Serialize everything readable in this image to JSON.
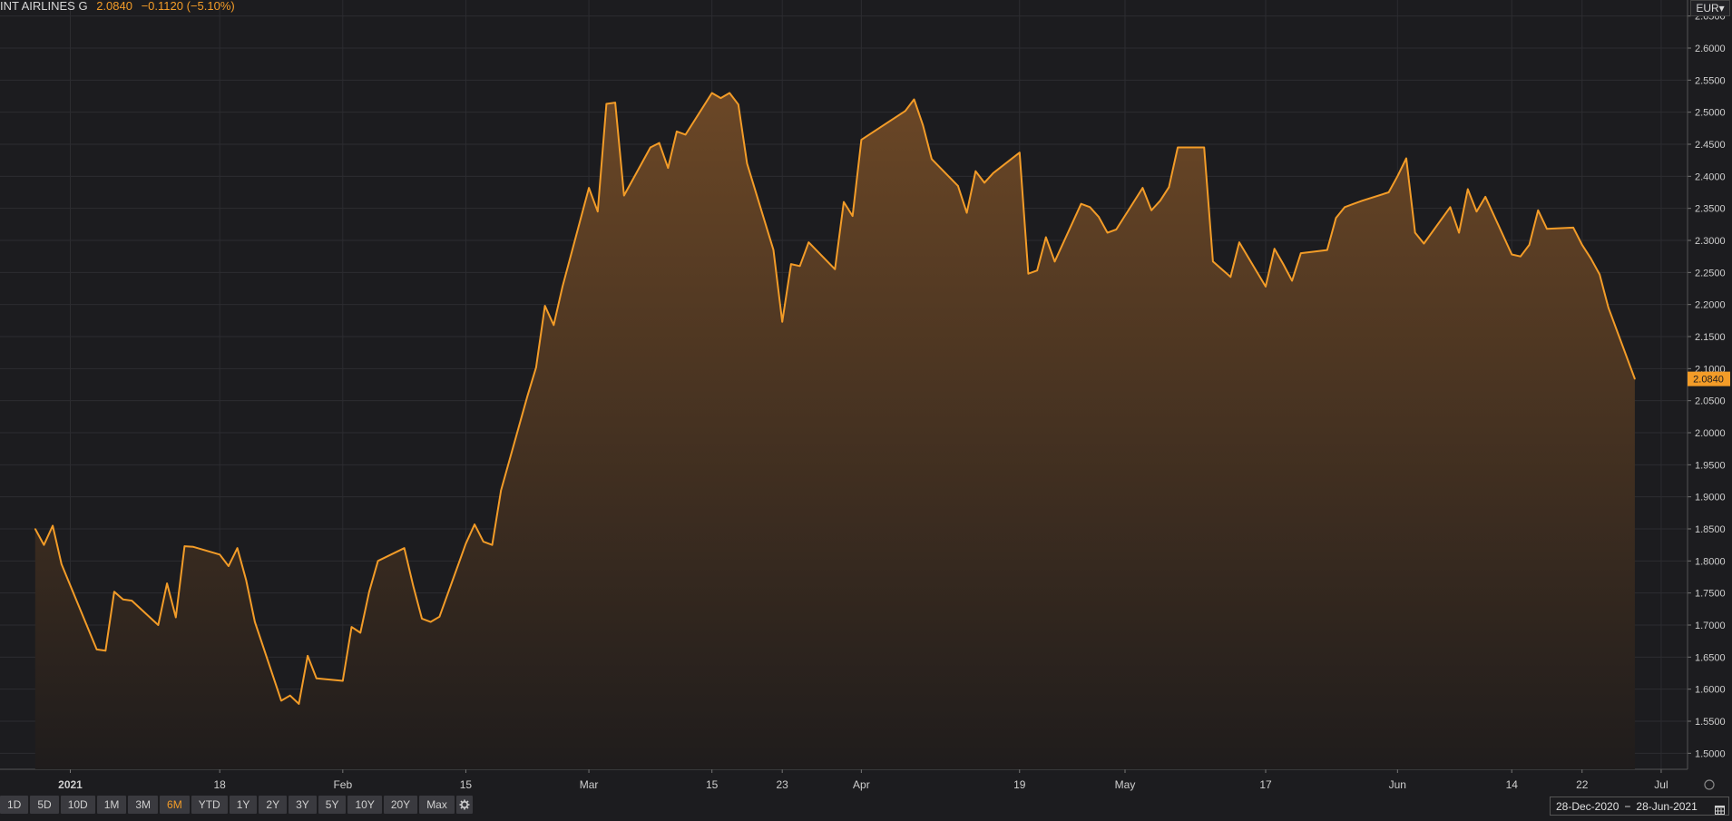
{
  "header": {
    "name": "INT AIRLINES G",
    "price": "2.0840",
    "change": "−0.1120 (−5.10%)"
  },
  "currency": "EUR▾",
  "ranges": [
    "1D",
    "5D",
    "10D",
    "1M",
    "3M",
    "6M",
    "YTD",
    "1Y",
    "2Y",
    "3Y",
    "5Y",
    "10Y",
    "20Y",
    "Max"
  ],
  "active_range": "6M",
  "date_range": {
    "from": "28-Dec-2020",
    "sep": "−",
    "to": "28-Jun-2021"
  },
  "colors": {
    "line": "#f39c28",
    "background": "#1c1c1f",
    "grid": "#2c2c30",
    "text": "#cfcfcf"
  },
  "chart_data": {
    "type": "area",
    "last_value_label": "2.0840",
    "ylim": [
      1.475,
      2.675
    ],
    "y_ticks": [
      "1.5000",
      "1.5500",
      "1.6000",
      "1.6500",
      "1.7000",
      "1.7500",
      "1.8000",
      "1.8500",
      "1.9000",
      "1.9500",
      "2.0000",
      "2.0500",
      "2.1000",
      "2.1500",
      "2.2000",
      "2.2500",
      "2.3000",
      "2.3500",
      "2.4000",
      "2.4500",
      "2.5000",
      "2.5500",
      "2.6000",
      "2.6500"
    ],
    "x_ticks": [
      {
        "label": "2021",
        "date": "2021-01-01",
        "bold": true
      },
      {
        "label": "18",
        "date": "2021-01-18"
      },
      {
        "label": "Feb",
        "date": "2021-02-01"
      },
      {
        "label": "15",
        "date": "2021-02-15"
      },
      {
        "label": "Mar",
        "date": "2021-03-01"
      },
      {
        "label": "15",
        "date": "2021-03-15"
      },
      {
        "label": "23",
        "date": "2021-03-23"
      },
      {
        "label": "Apr",
        "date": "2021-04-01"
      },
      {
        "label": "19",
        "date": "2021-04-19"
      },
      {
        "label": "May",
        "date": "2021-05-01"
      },
      {
        "label": "17",
        "date": "2021-05-17"
      },
      {
        "label": "Jun",
        "date": "2021-06-01"
      },
      {
        "label": "14",
        "date": "2021-06-14"
      },
      {
        "label": "22",
        "date": "2021-06-22"
      },
      {
        "label": "Jul",
        "date": "2021-07-01"
      }
    ],
    "series": [
      {
        "x": [
          "2020-12-28",
          "2020-12-29",
          "2020-12-30",
          "2020-12-31",
          "2021-01-04",
          "2021-01-05",
          "2021-01-06",
          "2021-01-07",
          "2021-01-08",
          "2021-01-11",
          "2021-01-12",
          "2021-01-13",
          "2021-01-14",
          "2021-01-15",
          "2021-01-18",
          "2021-01-19",
          "2021-01-20",
          "2021-01-21",
          "2021-01-22",
          "2021-01-25",
          "2021-01-26",
          "2021-01-27",
          "2021-01-28",
          "2021-01-29",
          "2021-02-01",
          "2021-02-02",
          "2021-02-03",
          "2021-02-04",
          "2021-02-05",
          "2021-02-08",
          "2021-02-09",
          "2021-02-10",
          "2021-02-11",
          "2021-02-12",
          "2021-02-15",
          "2021-02-16",
          "2021-02-17",
          "2021-02-18",
          "2021-02-19",
          "2021-02-22",
          "2021-02-23",
          "2021-02-24",
          "2021-02-25",
          "2021-02-26",
          "2021-03-01",
          "2021-03-02",
          "2021-03-03",
          "2021-03-04",
          "2021-03-05",
          "2021-03-08",
          "2021-03-09",
          "2021-03-10",
          "2021-03-11",
          "2021-03-12",
          "2021-03-15",
          "2021-03-16",
          "2021-03-17",
          "2021-03-18",
          "2021-03-19",
          "2021-03-22",
          "2021-03-23",
          "2021-03-24",
          "2021-03-25",
          "2021-03-26",
          "2021-03-29",
          "2021-03-30",
          "2021-03-31",
          "2021-04-01",
          "2021-04-06",
          "2021-04-07",
          "2021-04-08",
          "2021-04-09",
          "2021-04-12",
          "2021-04-13",
          "2021-04-14",
          "2021-04-15",
          "2021-04-16",
          "2021-04-19",
          "2021-04-20",
          "2021-04-21",
          "2021-04-22",
          "2021-04-23",
          "2021-04-26",
          "2021-04-27",
          "2021-04-28",
          "2021-04-29",
          "2021-04-30",
          "2021-05-03",
          "2021-05-04",
          "2021-05-05",
          "2021-05-06",
          "2021-05-07",
          "2021-05-10",
          "2021-05-11",
          "2021-05-12",
          "2021-05-13",
          "2021-05-14",
          "2021-05-17",
          "2021-05-18",
          "2021-05-19",
          "2021-05-20",
          "2021-05-21",
          "2021-05-24",
          "2021-05-25",
          "2021-05-26",
          "2021-05-27",
          "2021-05-28",
          "2021-05-31",
          "2021-06-01",
          "2021-06-02",
          "2021-06-03",
          "2021-06-04",
          "2021-06-07",
          "2021-06-08",
          "2021-06-09",
          "2021-06-10",
          "2021-06-11",
          "2021-06-14",
          "2021-06-15",
          "2021-06-16",
          "2021-06-17",
          "2021-06-18",
          "2021-06-21",
          "2021-06-22",
          "2021-06-23",
          "2021-06-24",
          "2021-06-25",
          "2021-06-28"
        ],
        "values": [
          1.85,
          1.825,
          1.855,
          1.795,
          1.662,
          1.66,
          1.752,
          1.74,
          1.738,
          1.7,
          1.765,
          1.712,
          1.823,
          1.822,
          1.81,
          1.792,
          1.82,
          1.77,
          1.705,
          1.582,
          1.59,
          1.577,
          1.652,
          1.617,
          1.613,
          1.697,
          1.688,
          1.752,
          1.8,
          1.82,
          1.762,
          1.71,
          1.705,
          1.713,
          1.827,
          1.857,
          1.83,
          1.825,
          1.91,
          2.057,
          2.102,
          2.198,
          2.168,
          2.228,
          2.382,
          2.345,
          2.513,
          2.515,
          2.37,
          2.445,
          2.452,
          2.413,
          2.47,
          2.465,
          2.53,
          2.522,
          2.53,
          2.512,
          2.42,
          2.285,
          2.173,
          2.263,
          2.26,
          2.297,
          2.255,
          2.36,
          2.338,
          2.457,
          2.502,
          2.52,
          2.48,
          2.427,
          2.385,
          2.343,
          2.408,
          2.39,
          2.405,
          2.437,
          2.248,
          2.253,
          2.305,
          2.267,
          2.357,
          2.352,
          2.337,
          2.312,
          2.317,
          2.382,
          2.347,
          2.362,
          2.383,
          2.445,
          2.445,
          2.267,
          2.255,
          2.243,
          2.297,
          2.228,
          2.287,
          2.263,
          2.237,
          2.28,
          2.285,
          2.335,
          2.352,
          2.357,
          2.362,
          2.375,
          2.4,
          2.428,
          2.312,
          2.295,
          2.352,
          2.312,
          2.38,
          2.345,
          2.368,
          2.278,
          2.275,
          2.293,
          2.347,
          2.318,
          2.32,
          2.293,
          2.272,
          2.247,
          2.195,
          2.084
        ]
      }
    ]
  }
}
